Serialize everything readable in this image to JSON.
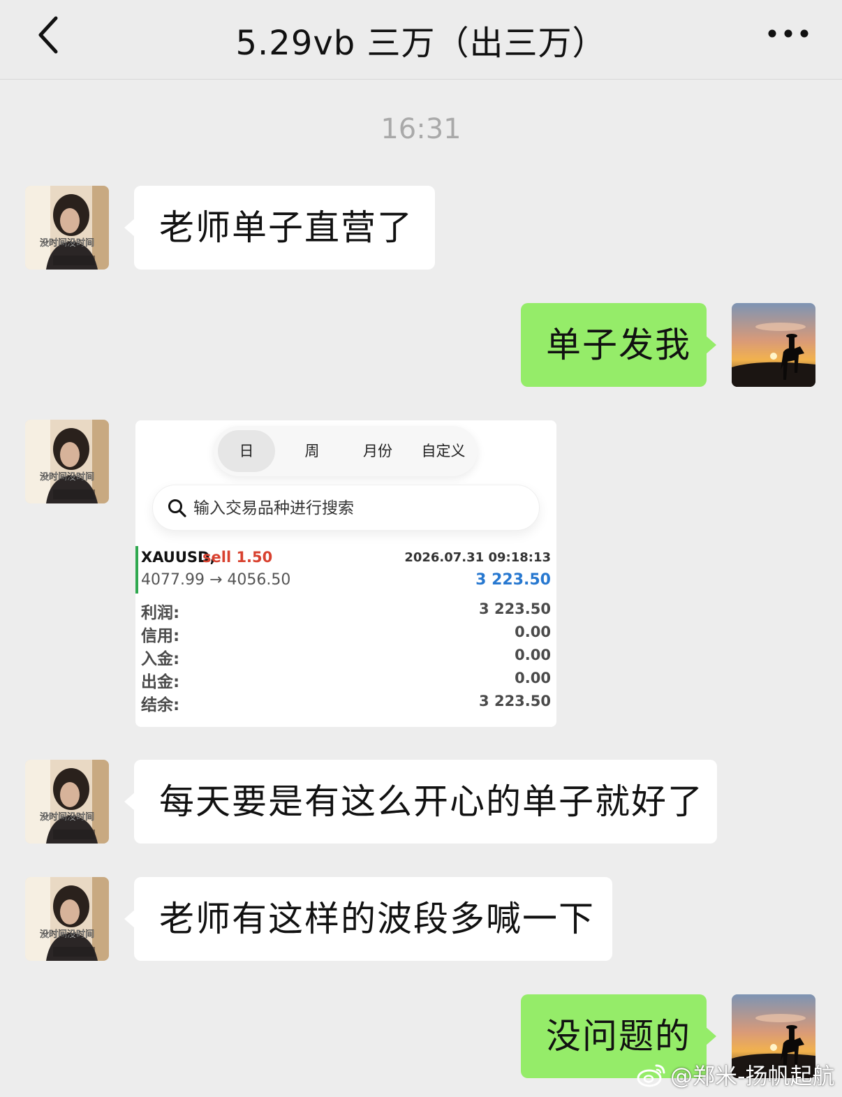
{
  "header": {
    "title": "5.29vb 三万（出三万）",
    "back_icon": "chevron-left-icon",
    "more_icon": "ellipsis-icon"
  },
  "time_stamp": "16:31",
  "messages": [
    {
      "side": "left",
      "text": "老师单子直营了"
    },
    {
      "side": "right",
      "text": "单子发我"
    },
    {
      "side": "left",
      "type": "image"
    },
    {
      "side": "left",
      "text": "每天要是有这么开心的单子就好了"
    },
    {
      "side": "left",
      "text": "老师有这样的波段多喊一下"
    },
    {
      "side": "right",
      "text": "没问题的"
    }
  ],
  "contact_avatar_caption": "没时间没时间",
  "trade_card": {
    "tabs": [
      "日",
      "周",
      "月份",
      "自定义"
    ],
    "active_tab": "日",
    "search_placeholder": "输入交易品种进行搜索",
    "order": {
      "symbol": "XAUUSD,",
      "side": "sell 1.50",
      "datetime": "2026.07.31 09:18:13",
      "prices": "4077.99 → 4056.50",
      "profit": "3 223.50"
    },
    "summary": [
      {
        "label": "利润:",
        "value": "3 223.50"
      },
      {
        "label": "信用:",
        "value": "0.00"
      },
      {
        "label": "入金:",
        "value": "0.00"
      },
      {
        "label": "出金:",
        "value": "0.00"
      },
      {
        "label": "结余:",
        "value": "3 223.50"
      }
    ]
  },
  "colors": {
    "background": "#ededed",
    "bubble_left": "#ffffff",
    "bubble_right": "#95ec69",
    "sell_red": "#d8412f",
    "profit_blue": "#2778d0",
    "order_bar_green": "#2fa84f"
  },
  "watermark": "@郑米-扬帆起航"
}
